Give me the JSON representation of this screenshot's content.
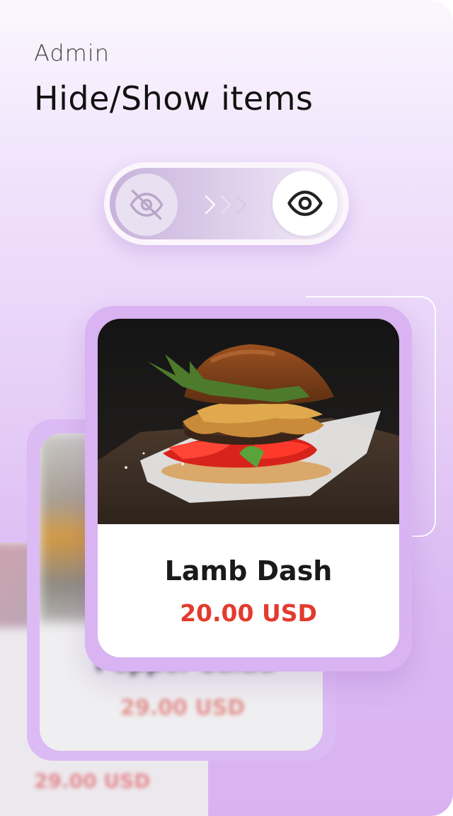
{
  "header": {
    "section_label": "Admin",
    "title": "Hide/Show items"
  },
  "toggle": {
    "left_icon": "eye-off-icon",
    "middle_icon": "chevrons-right-icon",
    "right_icon": "eye-icon",
    "state": "show"
  },
  "cards": {
    "featured": {
      "name": "Lamb Dash",
      "price": "20.00 USD",
      "image_icon": "burger-photo"
    },
    "behind": {
      "name": "Pepper Salad",
      "price": "29.00 USD"
    },
    "far_behind": {
      "price": "29.00 USD"
    }
  },
  "colors": {
    "accent": "#d9b3f2",
    "price": "#e23b2e",
    "text": "#1a1a1a"
  }
}
